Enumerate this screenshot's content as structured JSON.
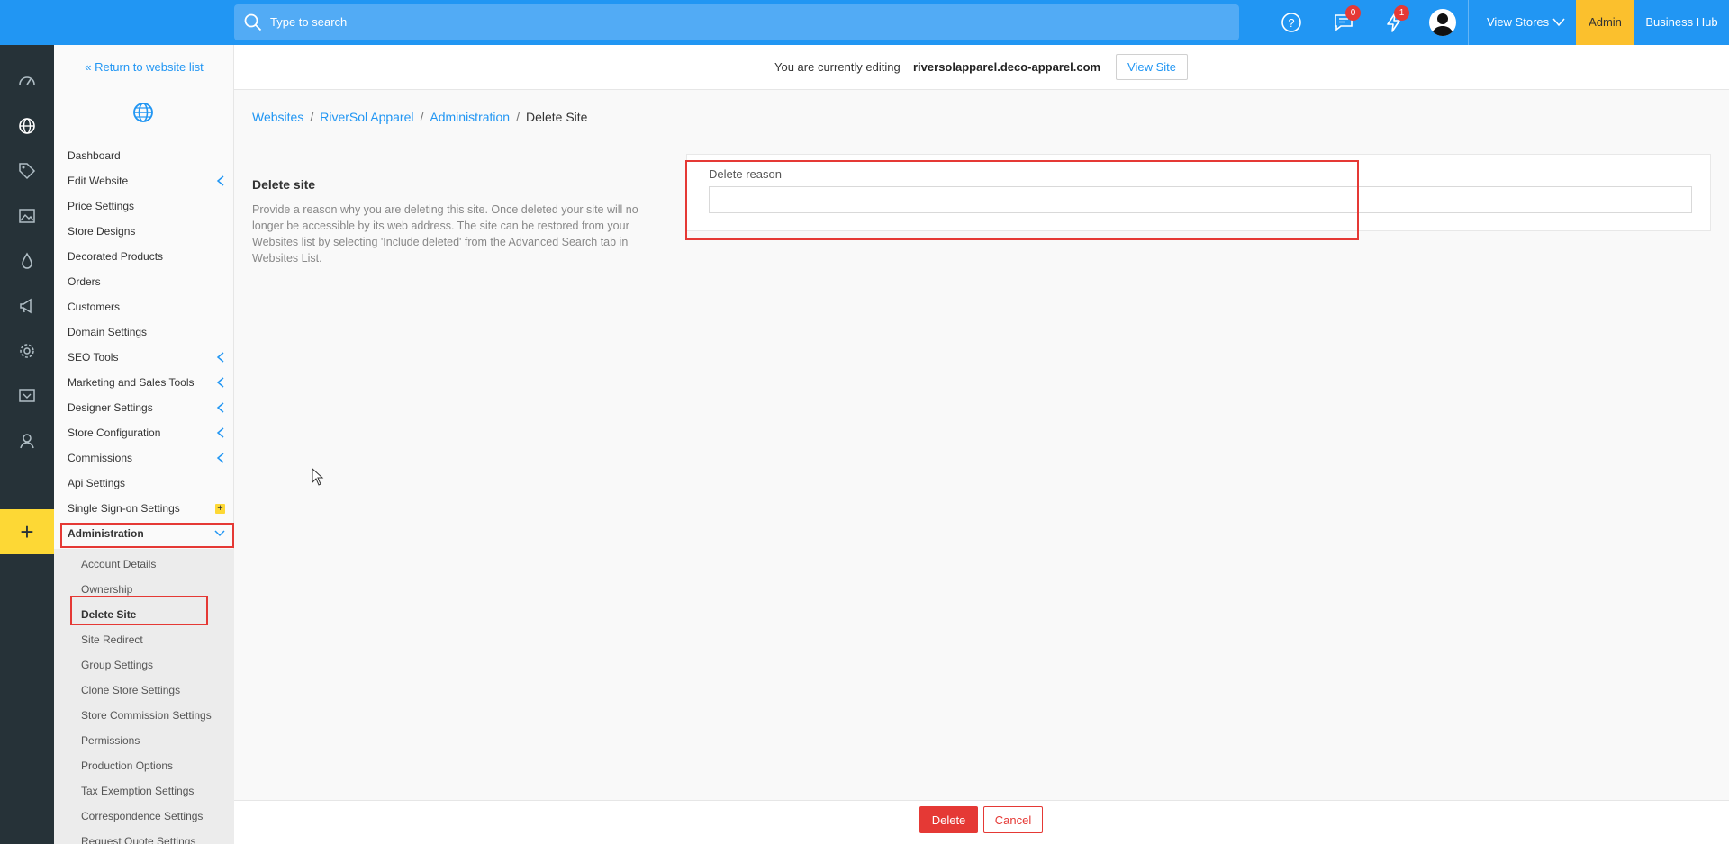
{
  "topbar": {
    "search_placeholder": "Type to search",
    "messages_badge": "0",
    "notifications_badge": "1",
    "view_stores_label": "View Stores",
    "admin_label": "Admin",
    "business_hub_label": "Business Hub"
  },
  "editbar": {
    "editing_text": "You are currently editing",
    "domain": "riversolapparel.deco-apparel.com",
    "view_site_label": "View Site"
  },
  "sidebar": {
    "return_link": "« Return to website list",
    "items": [
      {
        "label": "Dashboard"
      },
      {
        "label": "Edit Website"
      },
      {
        "label": "Price Settings"
      },
      {
        "label": "Store Designs"
      },
      {
        "label": "Decorated Products"
      },
      {
        "label": "Orders"
      },
      {
        "label": "Customers"
      },
      {
        "label": "Domain Settings"
      },
      {
        "label": "SEO Tools"
      },
      {
        "label": "Marketing and Sales Tools"
      },
      {
        "label": "Designer Settings"
      },
      {
        "label": "Store Configuration"
      },
      {
        "label": "Commissions"
      },
      {
        "label": "Api Settings"
      },
      {
        "label": "Single Sign-on Settings"
      },
      {
        "label": "Administration"
      }
    ],
    "sub_items": [
      {
        "label": "Account Details"
      },
      {
        "label": "Ownership"
      },
      {
        "label": "Delete Site"
      },
      {
        "label": "Site Redirect"
      },
      {
        "label": "Group Settings"
      },
      {
        "label": "Clone Store Settings"
      },
      {
        "label": "Store Commission Settings"
      },
      {
        "label": "Permissions"
      },
      {
        "label": "Production Options"
      },
      {
        "label": "Tax Exemption Settings"
      },
      {
        "label": "Correspondence Settings"
      },
      {
        "label": "Request Quote Settings"
      }
    ]
  },
  "breadcrumb": [
    "Websites",
    "RiverSol Apparel",
    "Administration",
    "Delete Site"
  ],
  "content": {
    "section_title": "Delete site",
    "section_description": "Provide a reason why you are deleting this site. Once deleted your site will no longer be accessible by its web address. The site can be restored from your Websites list by selecting 'Include deleted' from the Advanced Search tab in Websites List.",
    "field_label": "Delete reason",
    "field_value": ""
  },
  "footer": {
    "delete_label": "Delete",
    "cancel_label": "Cancel"
  },
  "colors": {
    "topbar": "#2196f3",
    "rail": "#263238",
    "accent_yellow": "#fbc02d",
    "danger": "#e53935"
  }
}
